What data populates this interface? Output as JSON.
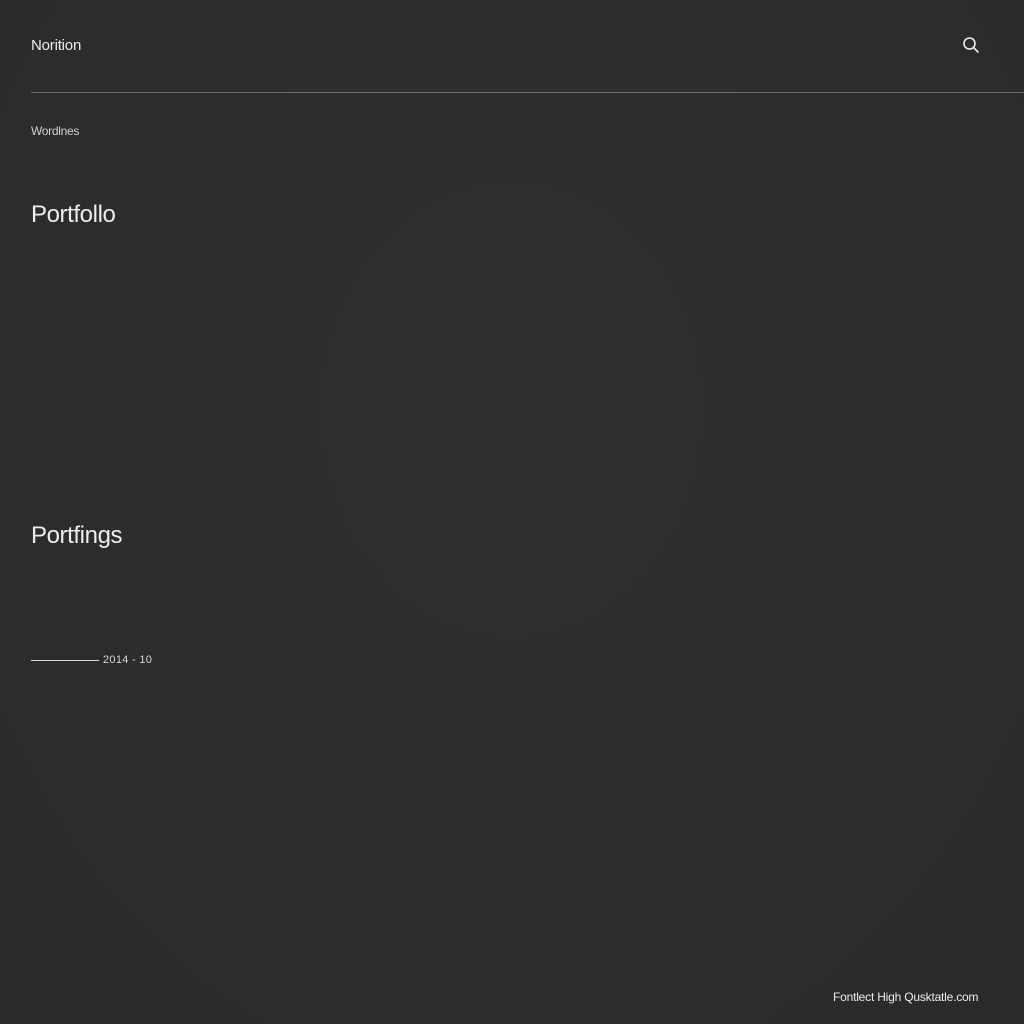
{
  "header": {
    "brand": "Norition",
    "search_icon": "search-icon"
  },
  "breadcrumb": "Wordlnes",
  "sections": {
    "heading_1": "Portfollo",
    "heading_2": "Portfings"
  },
  "range": {
    "label": "2014 - 10"
  },
  "footer": {
    "text": "Fontlect High Qusktatle.com"
  },
  "colors": {
    "background": "#2d2d2f",
    "text": "#ececec",
    "divider": "#6b6b6e"
  }
}
